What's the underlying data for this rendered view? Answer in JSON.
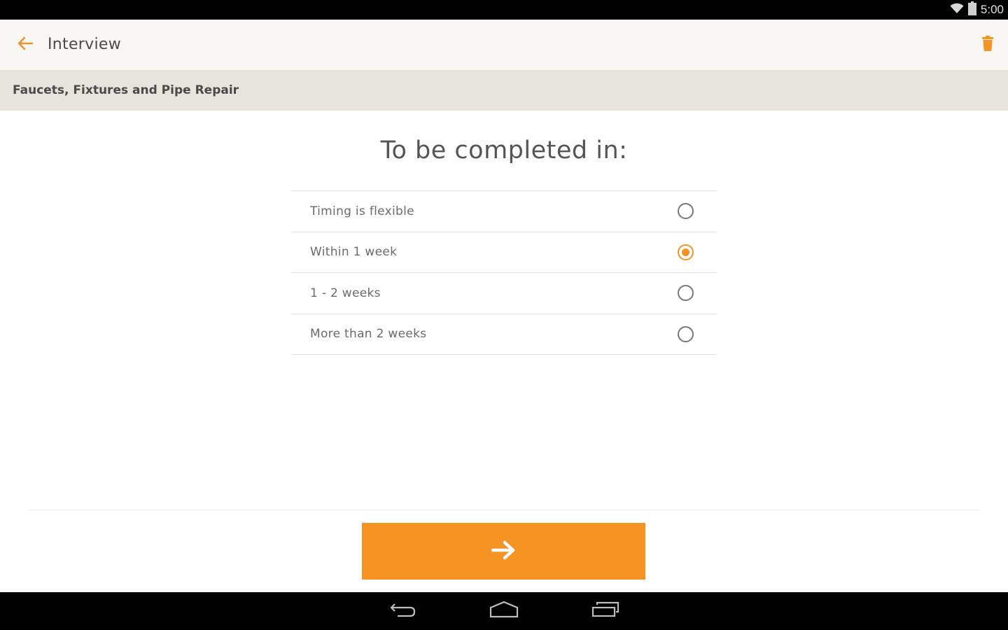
{
  "status_bar": {
    "time": "5:00",
    "icons": [
      "wifi-icon",
      "battery-icon"
    ]
  },
  "app_bar": {
    "title": "Interview",
    "back_icon": "arrow-left-icon",
    "action_icon": "trash-icon"
  },
  "category": {
    "label": "Faucets, Fixtures and Pipe Repair"
  },
  "question": {
    "title": "To be completed in:",
    "options": [
      {
        "label": "Timing is flexible",
        "selected": false
      },
      {
        "label": "Within 1 week",
        "selected": true
      },
      {
        "label": "1 - 2 weeks",
        "selected": false
      },
      {
        "label": "More than 2 weeks",
        "selected": false
      }
    ]
  },
  "next_button": {
    "icon": "arrow-right-icon"
  },
  "nav_bar": {
    "buttons": [
      "back-icon",
      "home-icon",
      "recent-apps-icon"
    ]
  },
  "colors": {
    "accent": "#f59323",
    "app_bar_bg": "#f8f7f3",
    "category_bg": "#e6e4dc",
    "text": "#4a4a4a"
  }
}
